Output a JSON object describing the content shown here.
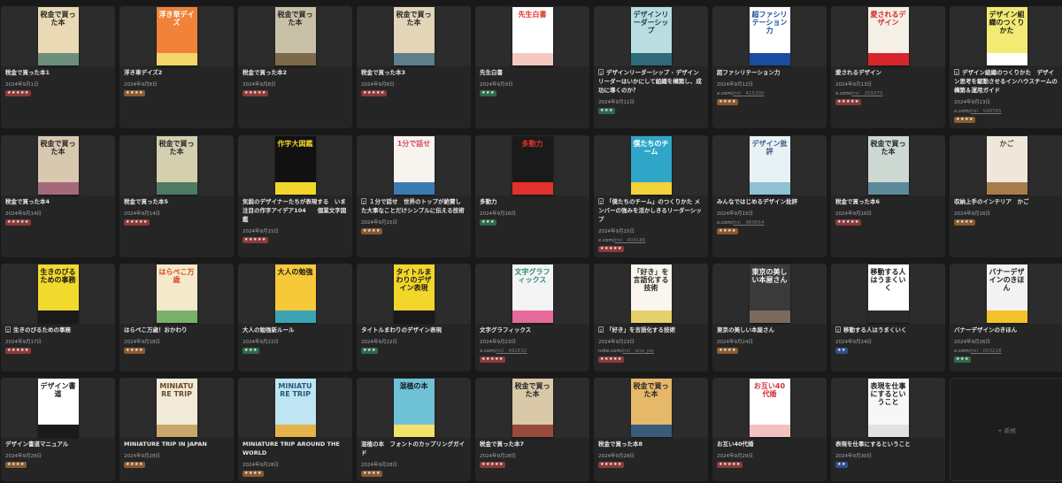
{
  "new_card_label": "+ 新規",
  "cards": [
    {
      "title": "税金で買った本1",
      "date": "2024年9月1日",
      "rating": "★★★★★",
      "rating_color": "#8a3a3a",
      "page": false,
      "url": "",
      "user": "",
      "cover_bg": "#e9d9b4",
      "cover_text": "税金で買った本",
      "cover_fg": "#2a2a2a",
      "band": "#6b8f7a"
    },
    {
      "title": "浮き車デイズ2",
      "date": "2024年9月8日",
      "rating": "★★★★",
      "rating_color": "#8a5a2e",
      "page": false,
      "url": "",
      "user": "",
      "cover_bg": "#f1823a",
      "cover_text": "浮き草デイズ",
      "cover_fg": "#ffffff",
      "band": "#f4d56a"
    },
    {
      "title": "税金で買った本2",
      "date": "2024年9月8日",
      "rating": "★★★★★",
      "rating_color": "#8a3a3a",
      "page": false,
      "url": "",
      "user": "",
      "cover_bg": "#c9c0a8",
      "cover_text": "税金で買った本",
      "cover_fg": "#2a2a2a",
      "band": "#7c6a4a"
    },
    {
      "title": "税金で買った本3",
      "date": "2024年9月8日",
      "rating": "★★★★★",
      "rating_color": "#8a3a3a",
      "page": false,
      "url": "",
      "user": "",
      "cover_bg": "#e3d5b8",
      "cover_text": "税金で買った本",
      "cover_fg": "#2a2a2a",
      "band": "#5d7e8a"
    },
    {
      "title": "先生白書",
      "date": "2024年9月9日",
      "rating": "★★★",
      "rating_color": "#2e6a48",
      "page": false,
      "url": "",
      "user": "",
      "cover_bg": "#ffffff",
      "cover_text": "先生白書",
      "cover_fg": "#e2342c",
      "band": "#f4c9c0"
    },
    {
      "title": "デザインリーダーシップ - デザインリーダーはいかにして組織を構築し、成功に導くのか？",
      "date": "2024年9月11日",
      "rating": "★★★",
      "rating_color": "#2e6a48",
      "page": true,
      "url": "",
      "user": "",
      "cover_bg": "#b9dde0",
      "cover_text": "デザインリーダーシップ",
      "cover_fg": "#1f3a4a",
      "band": "#2f6a7a"
    },
    {
      "title": "超ファシリテーション力",
      "date": "2024年9月12日",
      "rating": "★★★★",
      "rating_color": "#8a5a2e",
      "page": false,
      "url": "x.com/",
      "user": "mii__415300",
      "cover_bg": "#ffffff",
      "cover_text": "超ファシリテーション力",
      "cover_fg": "#1a4ca0",
      "band": "#1a4ca0"
    },
    {
      "title": "愛されるデザイン",
      "date": "2024年9月13日",
      "rating": "★★★★★",
      "rating_color": "#8a3a3a",
      "page": false,
      "url": "x.com/",
      "user": "mii__259375",
      "cover_bg": "#f5f0e6",
      "cover_text": "愛されるデザイン",
      "cover_fg": "#d6262b",
      "band": "#d6262b"
    },
    {
      "title": "デザイン組織のつくりかた　デザイン思考を駆動させるインハウスチームの構築＆運用ガイド",
      "date": "2024年9月13日",
      "rating": "★★★★",
      "rating_color": "#8a5a2e",
      "page": true,
      "url": "x.com/",
      "user": "mii__548765",
      "cover_bg": "#f3ea74",
      "cover_text": "デザイン組織のつくりかた",
      "cover_fg": "#1e1e1e",
      "band": "#ffffff"
    },
    {
      "title": "税金で買った本4",
      "date": "2024年9月14日",
      "rating": "★★★★★",
      "rating_color": "#8a3a3a",
      "page": false,
      "url": "",
      "user": "",
      "cover_bg": "#d9c8b0",
      "cover_text": "税金で買った本",
      "cover_fg": "#2a2a2a",
      "band": "#a46a7a"
    },
    {
      "title": "税金で買った本5",
      "date": "2024年9月14日",
      "rating": "★★★★★",
      "rating_color": "#8a3a3a",
      "page": false,
      "url": "",
      "user": "",
      "cover_bg": "#d4cfae",
      "cover_text": "税金で買った本",
      "cover_fg": "#2a2a2a",
      "band": "#4f7a64"
    },
    {
      "title": "気鋭のデザイナーたちが表現する　いま注目の作字アイデア104　　個業文字図鑑",
      "date": "2024年9月15日",
      "rating": "★★★★★",
      "rating_color": "#8a3a3a",
      "page": false,
      "url": "",
      "user": "",
      "cover_bg": "#111111",
      "cover_text": "作字大図鑑",
      "cover_fg": "#f2d62a",
      "band": "#f2d62a"
    },
    {
      "title": "１分で話せ　世界のトップが絶賛した大事なことだけシンプルに伝える技術",
      "date": "2024年9月15日",
      "rating": "★★★★",
      "rating_color": "#8a5a2e",
      "page": true,
      "url": "",
      "user": "",
      "cover_bg": "#f7f3ee",
      "cover_text": "1分で話せ",
      "cover_fg": "#d94b5a",
      "band": "#3a7bb4"
    },
    {
      "title": "多動力",
      "date": "2024年9月16日",
      "rating": "★★★",
      "rating_color": "#2e6a48",
      "page": false,
      "url": "",
      "user": "",
      "cover_bg": "#1a1a1a",
      "cover_text": "多動力",
      "cover_fg": "#e2312c",
      "band": "#e2312c"
    },
    {
      "title": "「僕たちのチーム」のつくりかた メンバーの強みを活かしきるリーダーシップ",
      "date": "2024年9月15日",
      "rating": "★★★★★",
      "rating_color": "#8a3a3a",
      "page": true,
      "url": "x.com/",
      "user": "mii__404186",
      "cover_bg": "#2fa6c8",
      "cover_text": "僕たちのチーム",
      "cover_fg": "#ffffff",
      "band": "#f2d33a"
    },
    {
      "title": "みんなではじめるデザイン批評",
      "date": "2024年9月15日",
      "rating": "★★★★",
      "rating_color": "#8a5a2e",
      "page": false,
      "url": "x.com/",
      "user": "mii__969654",
      "cover_bg": "#e8f1f4",
      "cover_text": "デザイン批評",
      "cover_fg": "#3a5a7a",
      "band": "#8fc0d4"
    },
    {
      "title": "税金で買った本6",
      "date": "2024年9月16日",
      "rating": "★★★★★",
      "rating_color": "#8a3a3a",
      "page": false,
      "url": "",
      "user": "",
      "cover_bg": "#cdd9d2",
      "cover_text": "税金で買った本",
      "cover_fg": "#2a2a2a",
      "band": "#5d8a9a"
    },
    {
      "title": "収納上手のインテリア　かご",
      "date": "2024年9月16日",
      "rating": "★★★★",
      "rating_color": "#8a5a2e",
      "page": false,
      "url": "",
      "user": "",
      "cover_bg": "#efe7dc",
      "cover_text": "かご",
      "cover_fg": "#6a4a2a",
      "band": "#a97a4a"
    },
    {
      "title": "生きのびるための事務",
      "date": "2024年9月17日",
      "rating": "★★★★★",
      "rating_color": "#8a3a3a",
      "page": true,
      "url": "",
      "user": "",
      "cover_bg": "#f2d92e",
      "cover_text": "生きのびるための事務",
      "cover_fg": "#1a1a1a",
      "band": "#1a1a1a"
    },
    {
      "title": "はらぺこ万歳！おかわり",
      "date": "2024年9月18日",
      "rating": "★★★★",
      "rating_color": "#8a5a2e",
      "page": false,
      "url": "",
      "user": "",
      "cover_bg": "#f4e9c9",
      "cover_text": "はらぺこ万歳",
      "cover_fg": "#d6452a",
      "band": "#7ab06a"
    },
    {
      "title": "大人の勉強新ルール",
      "date": "2024年9月22日",
      "rating": "★★★",
      "rating_color": "#2e6a48",
      "page": false,
      "url": "",
      "user": "",
      "cover_bg": "#f5c93a",
      "cover_text": "大人の勉強",
      "cover_fg": "#1a1a1a",
      "band": "#3aa4b4"
    },
    {
      "title": "タイトルまわりのデザイン表現",
      "date": "2024年9月22日",
      "rating": "★★★",
      "rating_color": "#2e6a48",
      "page": false,
      "url": "",
      "user": "",
      "cover_bg": "#f2d62a",
      "cover_text": "タイトルまわりのデザイン表現",
      "cover_fg": "#1a1a1a",
      "band": "#1a1a1a"
    },
    {
      "title": "文字グラフィックス",
      "date": "2024年9月23日",
      "rating": "★★★★★",
      "rating_color": "#8a3a3a",
      "page": false,
      "url": "x.com/",
      "user": "mii__492632",
      "cover_bg": "#f4f4f4",
      "cover_text": "文字グラフィックス",
      "cover_fg": "#2a8a7a",
      "band": "#e56a9a"
    },
    {
      "title": "「好き」を言語化する技術",
      "date": "2024年9月23日",
      "rating": "★★★★★",
      "rating_color": "#8a3a3a",
      "page": true,
      "url": "note.com/",
      "user": "mii__aira_pw",
      "cover_bg": "#faf6ee",
      "cover_text": "「好き」を言語化する技術",
      "cover_fg": "#2a2a2a",
      "band": "#e6d06a"
    },
    {
      "title": "東京の美しい本屋さん",
      "date": "2024年9月24日",
      "rating": "★★★★",
      "rating_color": "#8a5a2e",
      "page": false,
      "url": "",
      "user": "",
      "cover_bg": "#3a3a3a",
      "cover_text": "東京の美しい本屋さん",
      "cover_fg": "#f0f0f0",
      "band": "#7a6a5a"
    },
    {
      "title": "移動する人はうまくいく",
      "date": "2024年9月24日",
      "rating": "★★",
      "rating_color": "#2f4f8a",
      "page": true,
      "url": "",
      "user": "",
      "cover_bg": "#ffffff",
      "cover_text": "移動する人はうまくいく",
      "cover_fg": "#1a1a1a",
      "band": "#2a2a2a"
    },
    {
      "title": "バナーデザインのきほん",
      "date": "2024年9月26日",
      "rating": "★★★",
      "rating_color": "#2e6a48",
      "page": false,
      "url": "x.com/",
      "user": "mii__003218",
      "cover_bg": "#f2f2f2",
      "cover_text": "バナーデザインのきほん",
      "cover_fg": "#1a1a1a",
      "band": "#f2c22a"
    },
    {
      "title": "デザイン書道マニュアル",
      "date": "2024年9月28日",
      "rating": "★★★★",
      "rating_color": "#8a5a2e",
      "page": false,
      "url": "",
      "user": "",
      "cover_bg": "#ffffff",
      "cover_text": "デザイン書道",
      "cover_fg": "#1a1a1a",
      "band": "#1a1a1a"
    },
    {
      "title": "MINIATURE TRIP IN JAPAN",
      "date": "2024年9月28日",
      "rating": "★★★★",
      "rating_color": "#8a5a2e",
      "page": false,
      "url": "",
      "user": "",
      "cover_bg": "#f1ead9",
      "cover_text": "MINIATURE TRIP",
      "cover_fg": "#6a4a2a",
      "band": "#c9a76a"
    },
    {
      "title": "MINIATURE TRIP AROUND THE WORLD",
      "date": "2024年9月28日",
      "rating": "★★★★",
      "rating_color": "#8a5a2e",
      "page": false,
      "url": "",
      "user": "",
      "cover_bg": "#bfe4f2",
      "cover_text": "MINIATURE TRIP",
      "cover_fg": "#2a5a7a",
      "band": "#e4b44a"
    },
    {
      "title": "混植の本　フォントのカップリングガイド",
      "date": "2024年9月28日",
      "rating": "★★★★",
      "rating_color": "#8a5a2e",
      "page": false,
      "url": "",
      "user": "",
      "cover_bg": "#6fc1d6",
      "cover_text": "混植の本",
      "cover_fg": "#1a1a1a",
      "band": "#f2e26a"
    },
    {
      "title": "税金で買った本7",
      "date": "2024年9月28日",
      "rating": "★★★★★",
      "rating_color": "#8a3a3a",
      "page": false,
      "url": "",
      "user": "",
      "cover_bg": "#d9c9a9",
      "cover_text": "税金で買った本",
      "cover_fg": "#2a2a2a",
      "band": "#9a4a3a"
    },
    {
      "title": "税金で買った本8",
      "date": "2024年9月28日",
      "rating": "★★★★★",
      "rating_color": "#8a3a3a",
      "page": false,
      "url": "",
      "user": "",
      "cover_bg": "#e6b86a",
      "cover_text": "税金で買った本",
      "cover_fg": "#2a2a2a",
      "band": "#3a5a7a"
    },
    {
      "title": "お互い40代婚",
      "date": "2024年9月29日",
      "rating": "★★★★★",
      "rating_color": "#8a3a3a",
      "page": false,
      "url": "",
      "user": "",
      "cover_bg": "#ffffff",
      "cover_text": "お互い40代婚",
      "cover_fg": "#d6303a",
      "band": "#f2c2c2"
    },
    {
      "title": "表現を仕事にするということ",
      "date": "2024年9月30日",
      "rating": "★★",
      "rating_color": "#2f4f8a",
      "page": false,
      "url": "",
      "user": "",
      "cover_bg": "#f7f7f7",
      "cover_text": "表現を仕事にするということ",
      "cover_fg": "#1a1a1a",
      "band": "#e2e2e2"
    }
  ]
}
